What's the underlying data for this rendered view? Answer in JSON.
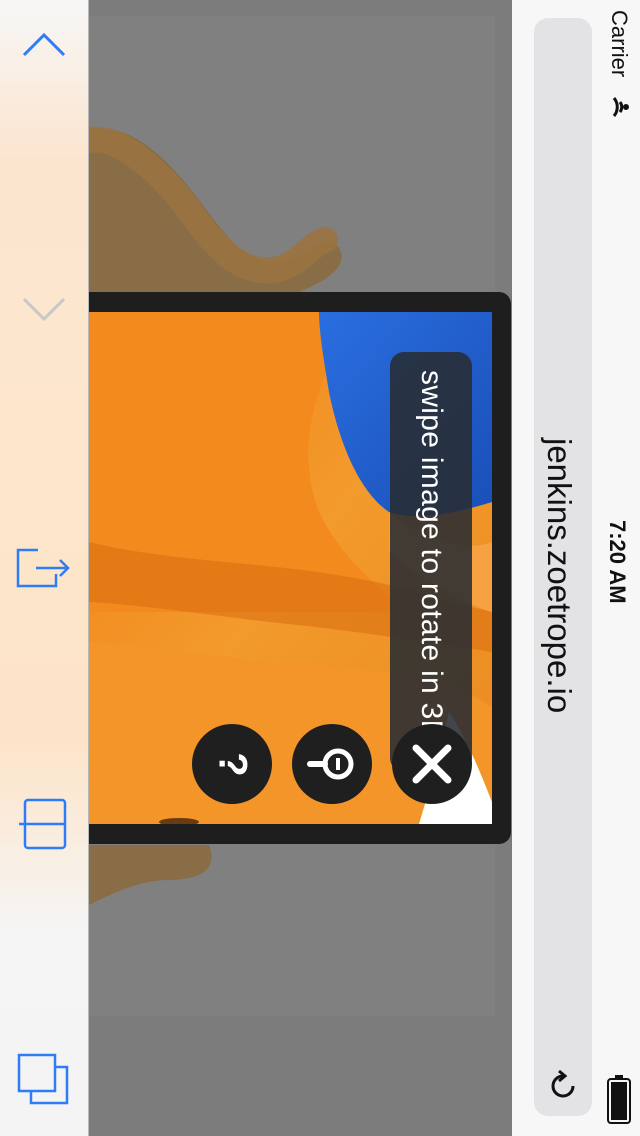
{
  "browser": {
    "url": "jenkins.zoetrope.io",
    "carrier": "Carrier",
    "time": "7:20 AM",
    "accent": "#2f7df6"
  },
  "toolbar": {
    "icons": [
      "chevron-up-icon",
      "chevron-down-icon",
      "share-icon",
      "bookmarks-icon",
      "tabs-icon"
    ]
  },
  "viewer": {
    "hint": "swipe image to rotate in 3D",
    "buttons": [
      "help-button",
      "zoom-button",
      "close-button"
    ],
    "help_glyph": "?",
    "close_glyph": "✕"
  }
}
